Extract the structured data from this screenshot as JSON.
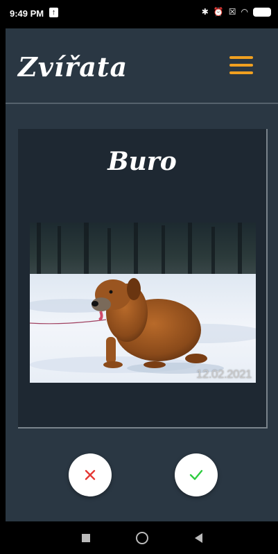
{
  "status_bar": {
    "time": "9:49 PM",
    "battery": "100",
    "icons": [
      "upload-icon",
      "bluetooth-icon",
      "alarm-off-icon",
      "sim-icon",
      "wifi-icon",
      "battery-icon"
    ]
  },
  "header": {
    "title": "Zvířata",
    "menu_icon": "hamburger-icon",
    "accent_color": "#f0a020"
  },
  "card": {
    "name": "Buro",
    "photo_date_stamp": "12.02.2021"
  },
  "actions": {
    "reject_icon": "close-icon",
    "accept_icon": "check-icon",
    "reject_color": "#e53935",
    "accept_color": "#2ecc40"
  },
  "nav": {
    "icons": [
      "recents-icon",
      "home-icon",
      "back-icon"
    ]
  }
}
